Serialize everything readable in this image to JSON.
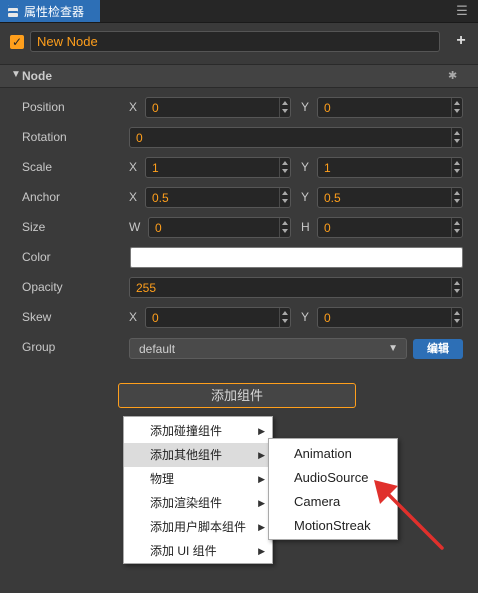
{
  "panel": {
    "tab_title": "属性检查器"
  },
  "node": {
    "enabled": true,
    "name": "New Node",
    "section_title": "Node"
  },
  "props": {
    "position": {
      "label": "Position",
      "x_axis": "X",
      "x": "0",
      "y_axis": "Y",
      "y": "0"
    },
    "rotation": {
      "label": "Rotation",
      "value": "0"
    },
    "scale": {
      "label": "Scale",
      "x_axis": "X",
      "x": "1",
      "y_axis": "Y",
      "y": "1"
    },
    "anchor": {
      "label": "Anchor",
      "x_axis": "X",
      "x": "0.5",
      "y_axis": "Y",
      "y": "0.5"
    },
    "size": {
      "label": "Size",
      "w_axis": "W",
      "w": "0",
      "h_axis": "H",
      "h": "0"
    },
    "color": {
      "label": "Color",
      "value": "#ffffff"
    },
    "opacity": {
      "label": "Opacity",
      "value": "255"
    },
    "skew": {
      "label": "Skew",
      "x_axis": "X",
      "x": "0",
      "y_axis": "Y",
      "y": "0"
    },
    "group": {
      "label": "Group",
      "value": "default",
      "edit_label": "编辑"
    }
  },
  "add_component_label": "添加组件",
  "context_menu": {
    "items": [
      {
        "label": "添加碰撞组件",
        "has_submenu": true
      },
      {
        "label": "添加其他组件",
        "has_submenu": true,
        "highlighted": true
      },
      {
        "label": "物理",
        "has_submenu": true
      },
      {
        "label": "添加渲染组件",
        "has_submenu": true
      },
      {
        "label": "添加用户脚本组件",
        "has_submenu": true
      },
      {
        "label": "添加 UI 组件",
        "has_submenu": true
      }
    ]
  },
  "submenu": {
    "items": [
      {
        "label": "Animation"
      },
      {
        "label": "AudioSource"
      },
      {
        "label": "Camera"
      },
      {
        "label": "MotionStreak"
      }
    ]
  },
  "colors": {
    "accent": "#ff9f1c",
    "tab_blue": "#2d6fb6",
    "panel_bg": "#3a3a3a",
    "pointer_red": "#e0302c"
  }
}
